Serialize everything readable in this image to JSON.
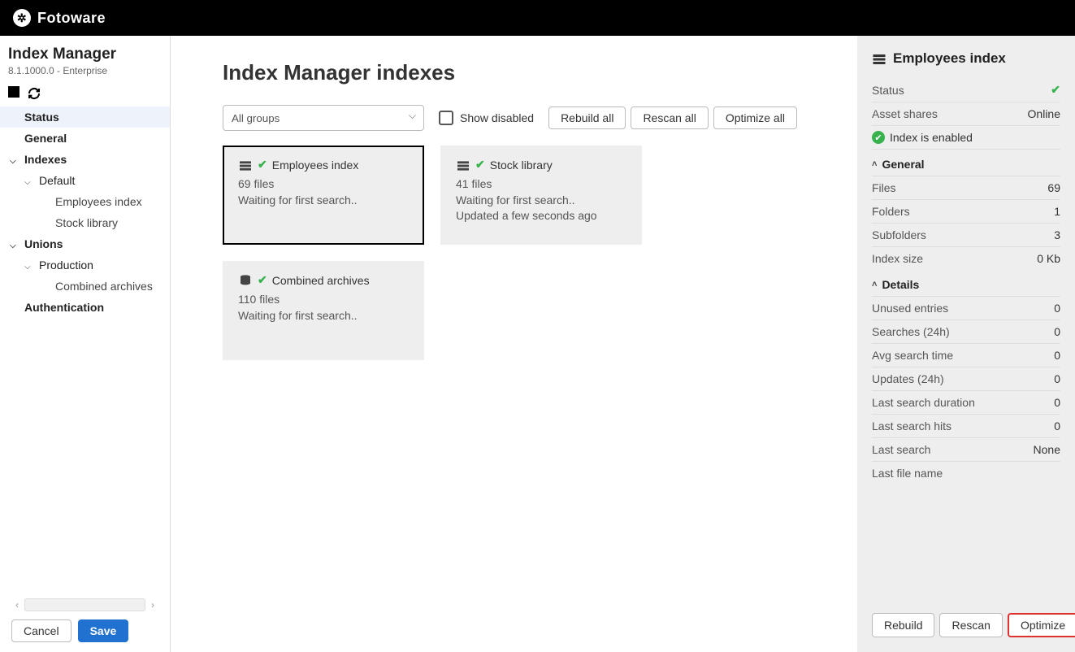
{
  "brand": "Fotoware",
  "sidebar": {
    "title": "Index Manager",
    "version": "8.1.1000.0 - Enterprise",
    "items": {
      "status": "Status",
      "general": "General",
      "indexes": "Indexes",
      "default": "Default",
      "employees": "Employees index",
      "stock": "Stock library",
      "unions": "Unions",
      "production": "Production",
      "combined": "Combined archives",
      "auth": "Authentication"
    },
    "buttons": {
      "cancel": "Cancel",
      "save": "Save"
    }
  },
  "content": {
    "heading": "Index Manager indexes",
    "group_filter": "All groups",
    "show_disabled": "Show disabled",
    "buttons": {
      "rebuild_all": "Rebuild all",
      "rescan_all": "Rescan all",
      "optimize_all": "Optimize all"
    },
    "cards": [
      {
        "name": "Employees index",
        "files": "69 files",
        "status1": "Waiting for first search..",
        "status2": "",
        "selected": true,
        "icon": "db"
      },
      {
        "name": "Stock library",
        "files": "41 files",
        "status1": "Waiting for first search..",
        "status2": "Updated a few seconds ago",
        "selected": false,
        "icon": "db"
      },
      {
        "name": "Combined archives",
        "files": "110 files",
        "status1": "Waiting for first search..",
        "status2": "",
        "selected": false,
        "icon": "stack"
      }
    ]
  },
  "panel": {
    "title": "Employees index",
    "status_label": "Status",
    "asset_shares_label": "Asset shares",
    "asset_shares_value": "Online",
    "enabled": "Index is enabled",
    "sections": {
      "general": {
        "label": "General",
        "rows": [
          {
            "label": "Files",
            "value": "69"
          },
          {
            "label": "Folders",
            "value": "1"
          },
          {
            "label": "Subfolders",
            "value": "3"
          },
          {
            "label": "Index size",
            "value": "0 Kb"
          }
        ]
      },
      "details": {
        "label": "Details",
        "rows": [
          {
            "label": "Unused entries",
            "value": "0"
          },
          {
            "label": "Searches (24h)",
            "value": "0"
          },
          {
            "label": "Avg search time",
            "value": "0"
          },
          {
            "label": "Updates (24h)",
            "value": "0"
          },
          {
            "label": "Last search duration",
            "value": "0"
          },
          {
            "label": "Last search hits",
            "value": "0"
          },
          {
            "label": "Last search",
            "value": "None"
          },
          {
            "label": "Last file name",
            "value": ""
          }
        ]
      }
    },
    "buttons": {
      "rebuild": "Rebuild",
      "rescan": "Rescan",
      "optimize": "Optimize"
    }
  }
}
